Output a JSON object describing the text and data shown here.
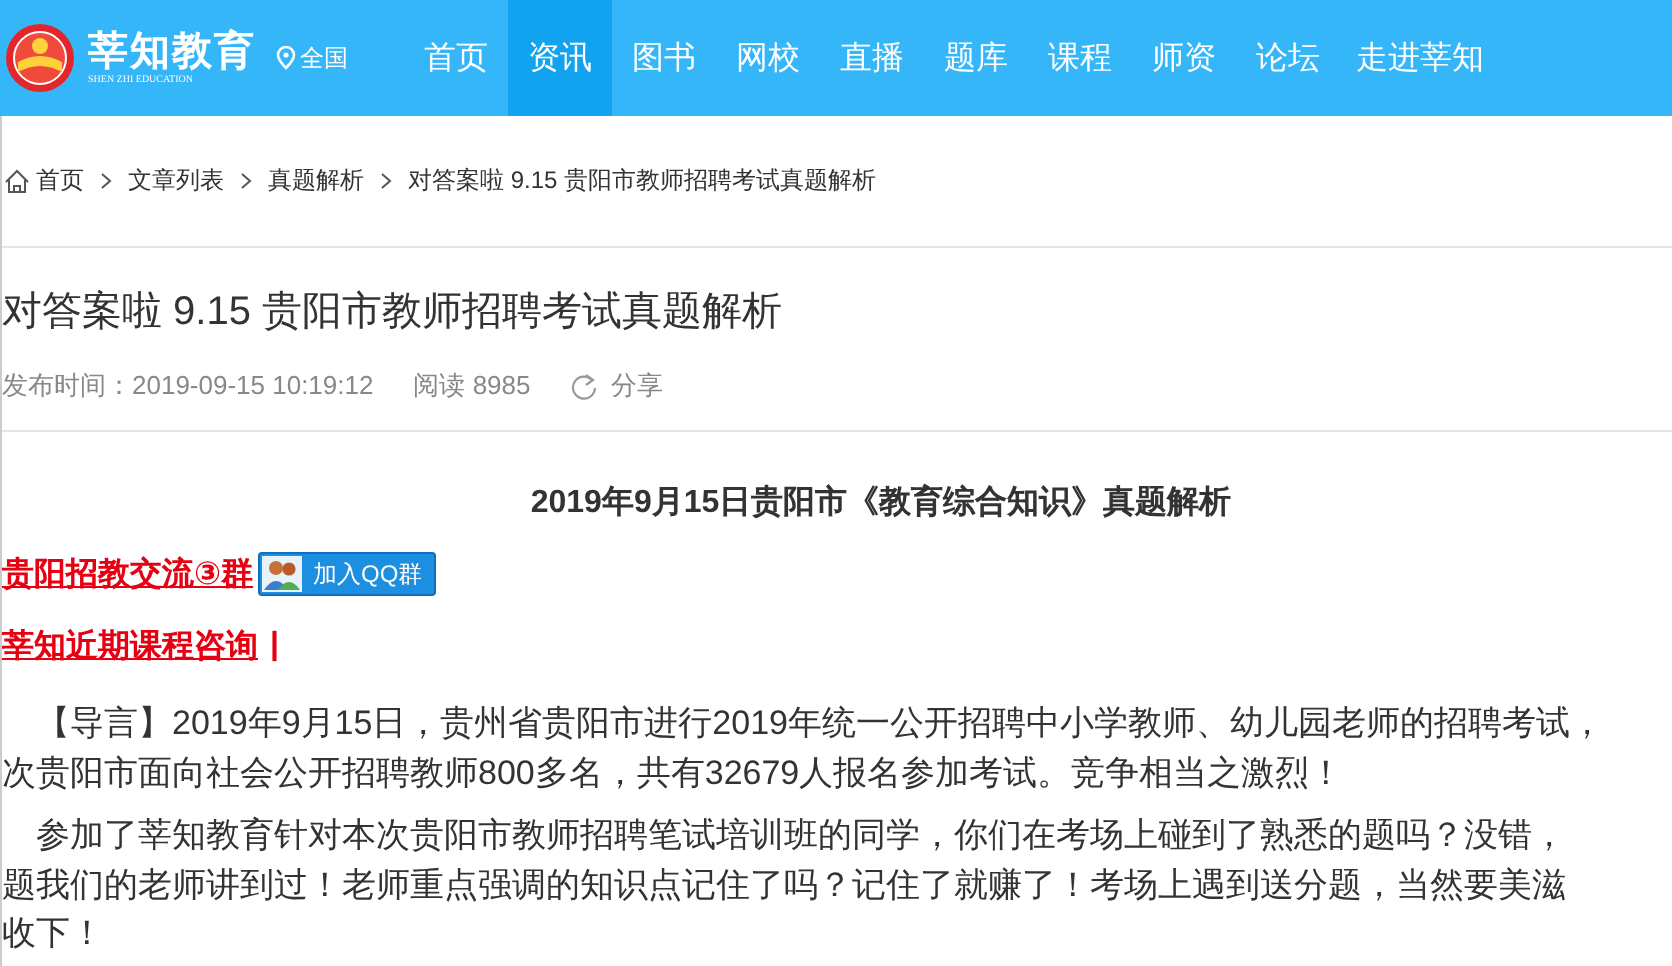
{
  "header": {
    "brand": "莘知教育",
    "brand_subtitle": "SHEN ZHI EDUCATION",
    "location": "全国",
    "nav": [
      {
        "label": "首页",
        "selected": false
      },
      {
        "label": "资讯",
        "selected": true
      },
      {
        "label": "图书",
        "selected": false
      },
      {
        "label": "网校",
        "selected": false
      },
      {
        "label": "直播",
        "selected": false
      },
      {
        "label": "题库",
        "selected": false
      },
      {
        "label": "课程",
        "selected": false
      },
      {
        "label": "师资",
        "selected": false
      },
      {
        "label": "论坛",
        "selected": false
      },
      {
        "label": "走进莘知",
        "selected": false
      }
    ]
  },
  "breadcrumb": [
    "首页",
    "文章列表",
    "真题解析",
    "对答案啦 9.15 贵阳市教师招聘考试真题解析"
  ],
  "article": {
    "title": "对答案啦 9.15 贵阳市教师招聘考试真题解析",
    "published": "发布时间：2019-09-15 10:19:12",
    "views": "阅读 8985",
    "share": "分享",
    "headline": "2019年9月15日贵阳市《教育综合知识》真题解析",
    "links": [
      {
        "kind": "group",
        "text": "贵阳招教交流③群",
        "button": "加入QQ群"
      },
      {
        "kind": "consult",
        "text": "莘知近期课程咨询",
        "suffix": "|"
      }
    ],
    "paragraphs": [
      [
        "【导言】2019年9月15日，贵州省贵阳市进行2019年统一公开招聘中小学教师、幼儿园老师的招聘考试，",
        "次贵阳市面向社会公开招聘教师800多名，共有32679人报名参加考试。竞争相当之激烈！"
      ],
      [
        "参加了莘知教育针对本次贵阳市教师招聘笔试培训班的同学，你们在考场上碰到了熟悉的题吗？没错，",
        "题我们的老师讲到过！老师重点强调的知识点记住了吗？记住了就赚了！考场上遇到送分题，当然要美滋",
        "收下！"
      ]
    ]
  }
}
